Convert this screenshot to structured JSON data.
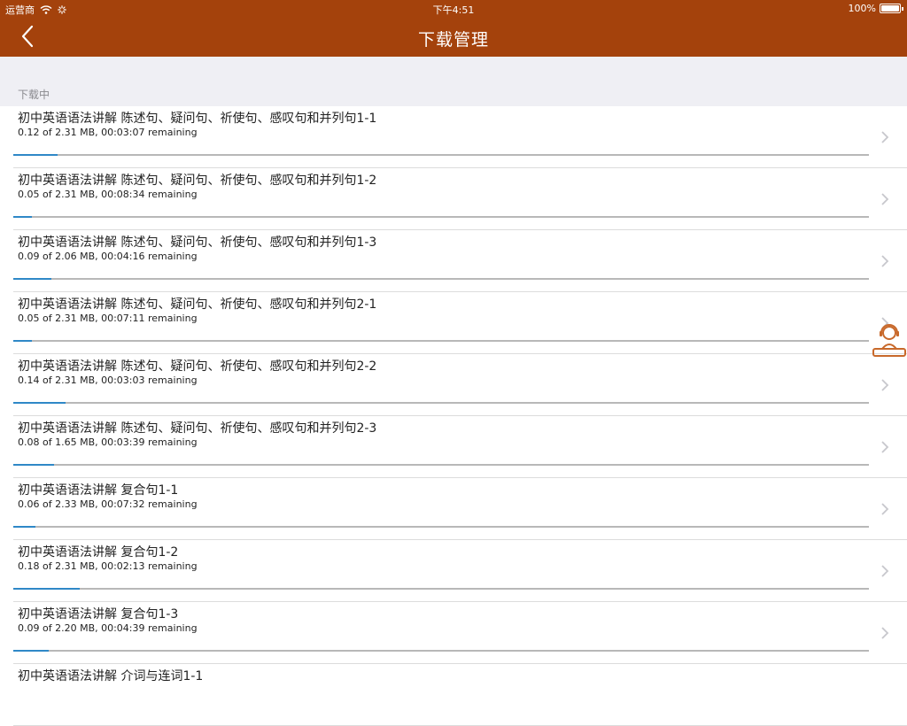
{
  "status_bar": {
    "carrier": "运营商",
    "time": "下午4:51",
    "battery_percent": "100%"
  },
  "nav": {
    "title": "下载管理",
    "back_icon": "chevron-left-icon"
  },
  "section": {
    "label": "下载中"
  },
  "downloads": [
    {
      "title": "初中英语语法讲解 陈述句、疑问句、祈使句、感叹句和并列句1-1",
      "status": "0.12 of 2.31 MB, 00:03:07 remaining",
      "progress": 0.052
    },
    {
      "title": "初中英语语法讲解 陈述句、疑问句、祈使句、感叹句和并列句1-2",
      "status": "0.05 of 2.31 MB, 00:08:34 remaining",
      "progress": 0.022
    },
    {
      "title": "初中英语语法讲解 陈述句、疑问句、祈使句、感叹句和并列句1-3",
      "status": "0.09 of 2.06 MB, 00:04:16 remaining",
      "progress": 0.044
    },
    {
      "title": "初中英语语法讲解 陈述句、疑问句、祈使句、感叹句和并列句2-1",
      "status": "0.05 of 2.31 MB, 00:07:11 remaining",
      "progress": 0.022
    },
    {
      "title": "初中英语语法讲解 陈述句、疑问句、祈使句、感叹句和并列句2-2",
      "status": "0.14 of 2.31 MB, 00:03:03 remaining",
      "progress": 0.061
    },
    {
      "title": "初中英语语法讲解 陈述句、疑问句、祈使句、感叹句和并列句2-3",
      "status": "0.08 of 1.65 MB, 00:03:39 remaining",
      "progress": 0.048
    },
    {
      "title": "初中英语语法讲解 复合句1-1",
      "status": "0.06 of 2.33 MB, 00:07:32 remaining",
      "progress": 0.026
    },
    {
      "title": "初中英语语法讲解 复合句1-2",
      "status": "0.18 of 2.31 MB, 00:02:13 remaining",
      "progress": 0.078
    },
    {
      "title": "初中英语语法讲解 复合句1-3",
      "status": "0.09 of 2.20 MB, 00:04:39 remaining",
      "progress": 0.041
    },
    {
      "title": "初中英语语法讲解 介词与连词1-1",
      "status": "",
      "progress": null
    }
  ],
  "colors": {
    "brand": "#a4420c",
    "progress_fill": "#2f88c7",
    "progress_track": "#b8b8b8",
    "section_bg": "#efeff4",
    "support_icon": "#c8692b"
  },
  "icons": {
    "row_chevron": "chevron-right-icon",
    "floating_support": "customer-service-icon"
  }
}
